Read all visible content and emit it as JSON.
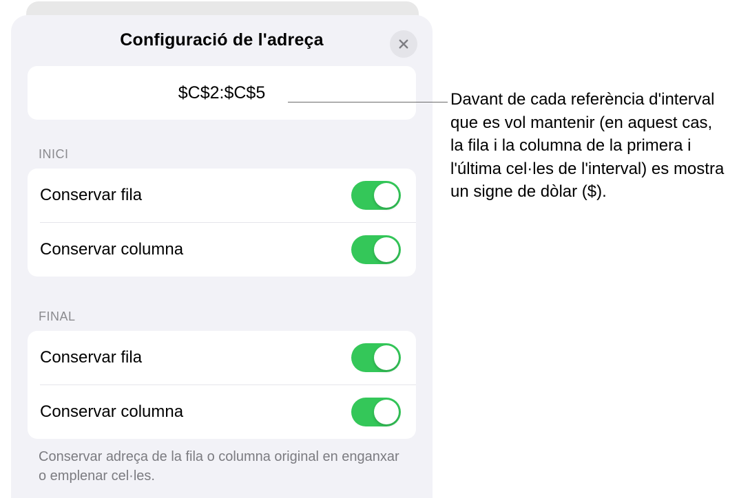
{
  "header": {
    "title": "Configuració de l'adreça"
  },
  "address": {
    "value": "$C$2:$C$5"
  },
  "sections": {
    "start": {
      "label": "INICI",
      "rows": [
        {
          "label": "Conservar fila",
          "on": true
        },
        {
          "label": "Conservar columna",
          "on": true
        }
      ]
    },
    "end": {
      "label": "FINAL",
      "rows": [
        {
          "label": "Conservar fila",
          "on": true
        },
        {
          "label": "Conservar columna",
          "on": true
        }
      ]
    }
  },
  "footer_note": "Conservar adreça de la fila o columna original en enganxar o emplenar cel·les.",
  "callout": {
    "text": "Davant de cada referència d'interval que es vol mantenir (en aquest cas, la fila i la columna de la primera i l'última cel·les de l'interval) es mostra un signe de dòlar ($)."
  }
}
